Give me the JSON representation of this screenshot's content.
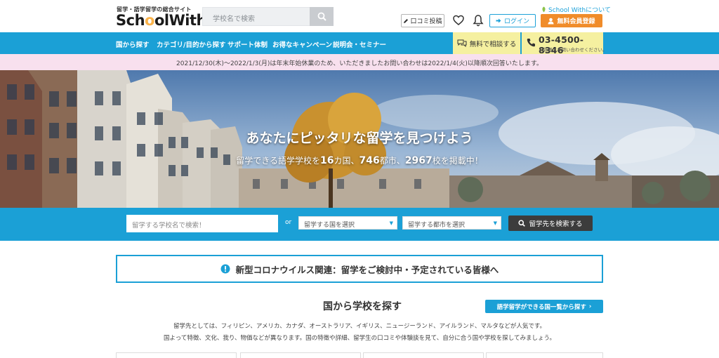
{
  "header": {
    "tagline": "留学・語学留学の総合サイト",
    "logo_part1": "Sch",
    "logo_accent": "o",
    "logo_part2": "ol",
    "logo_part3": "With",
    "search_placeholder": "学校名で検索",
    "review_button": "口コミ投稿",
    "login_button": "ログイン",
    "about_link": "School Withについて",
    "register_button": "無料会員登録"
  },
  "nav": {
    "items": [
      {
        "label": "国から探す"
      },
      {
        "label": "カテゴリ/目的から探す"
      },
      {
        "label": "サポート体制"
      },
      {
        "label": "お得なキャンペーン"
      },
      {
        "label": "説明会・セミナー"
      }
    ],
    "consult_button": "無料で相談する",
    "phone": "03-4500-8346",
    "phone_note": "お気軽にお問い合わせください。"
  },
  "notice": "2021/12/30(木)〜2022/1/3(月)は年末年始休業のため、いただきましたお問い合わせは2022/1/4(火)以降順次回答いたします。",
  "hero": {
    "title": "あなたにピッタリな留学を見つけよう",
    "sub_prefix": "留学できる語学学校を",
    "sub_countries": "16",
    "sub_countries_unit": "カ国、",
    "sub_cities": "746",
    "sub_cities_unit": "都市、",
    "sub_schools": "2967",
    "sub_schools_unit": "校を掲載中！"
  },
  "search": {
    "keyword_placeholder": "留学する学校名で検索！",
    "or": "or",
    "country_select": "留学する国を選択",
    "city_select": "留学する都市を選択",
    "submit": "留学先を検索する"
  },
  "covid": {
    "text": "新型コロナウイルス関連：留学をご検討中・予定されている皆様へ"
  },
  "country_section": {
    "title": "国から学校を探す",
    "list_button": "語学留学ができる国一覧から探す",
    "desc1": "留学先としては、フィリピン、アメリカ、カナダ、オーストラリア、イギリス、ニュージーランド、アイルランド、マルタなどが人気です。",
    "desc2": "国よって特徴、文化、我り、物価などが異なります。国の特徴や詳細、留学生の口コミや体験談を見て、自分に合う国や学校を探してみましょう。"
  },
  "colors": {
    "brand_blue": "#1ba0d6",
    "accent_orange": "#f08c2a",
    "notice_pink": "#f8e0ee",
    "consult_yellow": "#f5f0a0"
  }
}
